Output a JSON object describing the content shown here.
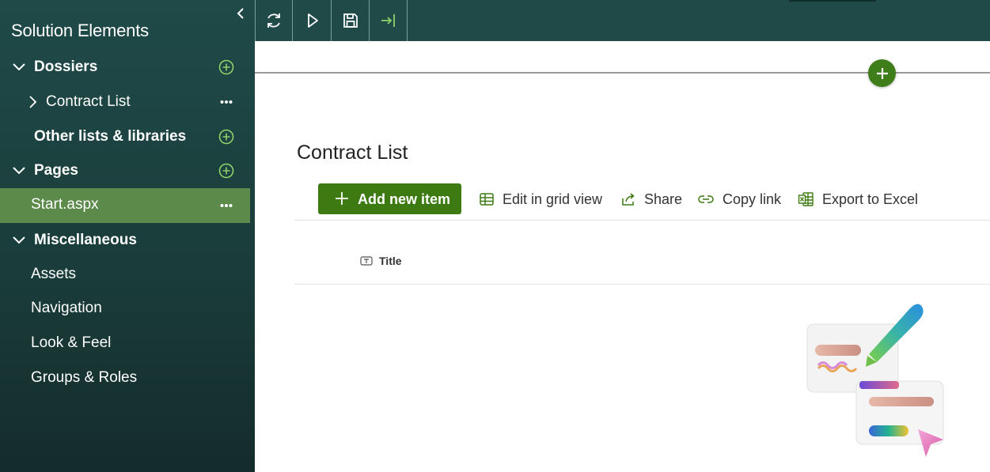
{
  "sidebar": {
    "title": "Solution Elements",
    "collapse_icon": "chevron-left-icon",
    "items": [
      {
        "label": "Dossiers",
        "bold": true,
        "icon": "add-circle-icon"
      },
      {
        "label": "Contract List",
        "bold": false,
        "icon": "more-icon"
      },
      {
        "label": "Other lists & libraries",
        "bold": true,
        "icon": "add-circle-icon"
      },
      {
        "label": "Pages",
        "bold": true,
        "icon": "add-circle-icon"
      },
      {
        "label": "Start.aspx",
        "bold": false,
        "icon": "more-icon",
        "selected": true
      },
      {
        "label": "Miscellaneous",
        "bold": true
      },
      {
        "label": "Assets"
      },
      {
        "label": "Navigation"
      },
      {
        "label": "Look & Feel"
      },
      {
        "label": "Groups & Roles"
      }
    ]
  },
  "toolbar": {
    "buttons": [
      "refresh-icon",
      "play-icon",
      "save-icon",
      "exit-icon"
    ]
  },
  "list": {
    "title": "Contract List",
    "commands": {
      "add_new": "Add new item",
      "edit_grid": "Edit in grid view",
      "share": "Share",
      "copy_link": "Copy link",
      "export": "Export to Excel"
    },
    "column_title": "Title"
  },
  "colors": {
    "sidebar_bg": "#1f4a48",
    "selected_bg": "#5b8a4a",
    "accent_green": "#3e7a12",
    "icon_green": "#8fd16a"
  }
}
